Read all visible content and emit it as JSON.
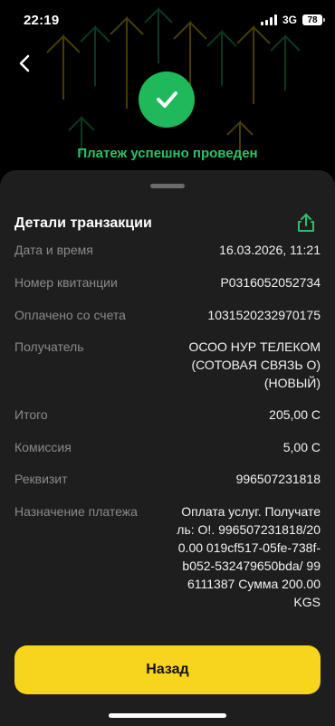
{
  "status_bar": {
    "time": "22:19",
    "network": "3G",
    "battery": "78"
  },
  "hero": {
    "title": "Платеж успешно проведен",
    "back_icon": "chevron-left-icon",
    "success_icon": "check-circle-icon"
  },
  "details": {
    "title": "Детали транзакции",
    "share_icon": "share-icon",
    "rows": [
      {
        "label": "Дата и время",
        "value": "16.03.2026, 11:21"
      },
      {
        "label": "Номер квитанции",
        "value": "P0316052052734"
      },
      {
        "label": "Оплачено со счета",
        "value": "1031520232970175"
      },
      {
        "label": "Получатель",
        "value": "ОСОО НУР ТЕЛЕКОМ (СОТОВАЯ СВЯЗЬ О) (НОВЫЙ)"
      },
      {
        "label": "Итого",
        "value": "205,00 С"
      },
      {
        "label": "Комиссия",
        "value": "5,00 С"
      },
      {
        "label": "Реквизит",
        "value": "996507231818"
      },
      {
        "label": "Назначение платежа",
        "value": "Оплата услуг. Получатель: О!. 996507231818/200.00 019cf517-05fe-738f-b052-532479650bda/ 996111387 Сумма 200.00 KGS"
      }
    ]
  },
  "actions": {
    "back_label": "Назад"
  },
  "colors": {
    "success": "#1fb85a",
    "accent": "#f7d51f",
    "sheet": "#1e1e1e"
  }
}
